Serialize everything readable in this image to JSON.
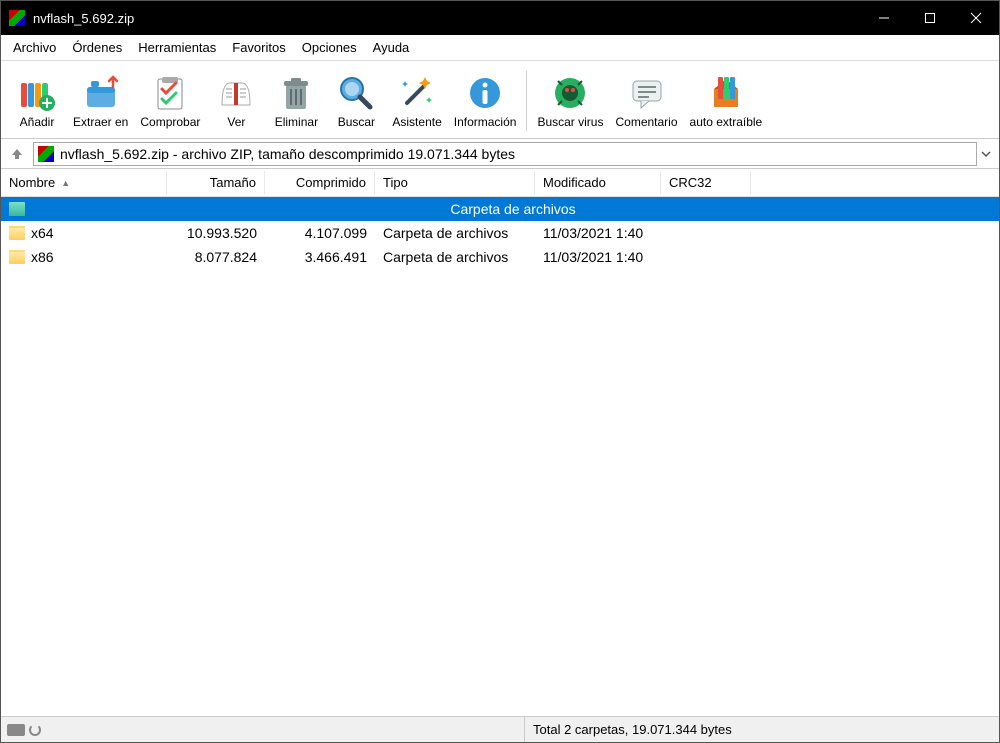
{
  "title": "nvflash_5.692.zip",
  "menu": [
    "Archivo",
    "Órdenes",
    "Herramientas",
    "Favoritos",
    "Opciones",
    "Ayuda"
  ],
  "toolbar": [
    {
      "label": "Añadir",
      "icon": "add"
    },
    {
      "label": "Extraer en",
      "icon": "extract"
    },
    {
      "label": "Comprobar",
      "icon": "test"
    },
    {
      "label": "Ver",
      "icon": "view"
    },
    {
      "label": "Eliminar",
      "icon": "delete"
    },
    {
      "label": "Buscar",
      "icon": "find"
    },
    {
      "label": "Asistente",
      "icon": "wizard"
    },
    {
      "label": "Información",
      "icon": "info"
    }
  ],
  "toolbar2": [
    {
      "label": "Buscar virus",
      "icon": "virus"
    },
    {
      "label": "Comentario",
      "icon": "comment"
    },
    {
      "label": "auto extraíble",
      "icon": "sfx"
    }
  ],
  "address": "nvflash_5.692.zip - archivo ZIP, tamaño descomprimido 19.071.344 bytes",
  "columns": {
    "name": "Nombre",
    "size": "Tamaño",
    "comp": "Comprimido",
    "type": "Tipo",
    "mod": "Modificado",
    "crc": "CRC32"
  },
  "parent_row": {
    "name": "..",
    "type": "Carpeta de archivos"
  },
  "rows": [
    {
      "name": "x64",
      "size": "10.993.520",
      "comp": "4.107.099",
      "type": "Carpeta de archivos",
      "mod": "11/03/2021 1:40",
      "crc": ""
    },
    {
      "name": "x86",
      "size": "8.077.824",
      "comp": "3.466.491",
      "type": "Carpeta de archivos",
      "mod": "11/03/2021 1:40",
      "crc": ""
    }
  ],
  "status": "Total 2 carpetas, 19.071.344 bytes"
}
